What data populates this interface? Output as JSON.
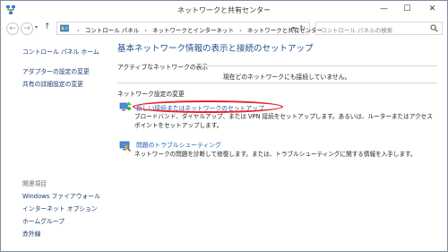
{
  "window": {
    "title": "ネットワークと共有センター",
    "controls": {
      "minimize": "—",
      "maximize": "☐",
      "close": "✕"
    }
  },
  "nav": {
    "back": "←",
    "forward": "→",
    "recent": "▾",
    "up": "↑",
    "breadcrumbs": [
      "コントロール パネル",
      "ネットワークとインターネット",
      "ネットワークと共有センター"
    ],
    "crumb_separator": "›",
    "address_dropdown": "▾",
    "refresh": "↻",
    "search_placeholder": "コントロール パネルの検索"
  },
  "sidebar": {
    "home_link": "コントロール パネル ホーム",
    "links": [
      "アダプターの設定の変更",
      "共有の詳細設定の変更"
    ],
    "related_heading": "関連項目",
    "related_links": [
      "Windows ファイアウォール",
      "インターネット オプション",
      "ホームグループ",
      "赤外線"
    ]
  },
  "main": {
    "title": "基本ネットワーク情報の表示と接続のセットアップ",
    "active_networks_label": "アクティブなネットワークの表示",
    "no_network_text": "現在どのネットワークにも接続していません。",
    "settings_label": "ネットワーク設定の変更",
    "tasks": [
      {
        "link": "新しい接続またはネットワークのセットアップ",
        "description": "ブロードバンド、ダイヤルアップ、または VPN 接続をセットアップします。あるいは、ルーターまたはアクセス ポイントをセットアップします。",
        "icon": "network-setup-icon"
      },
      {
        "link": "問題のトラブルシューティング",
        "description": "ネットワークの問題を診断して修復します。または、トラブルシューティングに関する情報を入手します。",
        "icon": "troubleshoot-icon"
      }
    ]
  },
  "colors": {
    "title_blue": "#1e4f8c",
    "link_blue": "#1a5fb4",
    "highlight_red": "#e8232b"
  }
}
